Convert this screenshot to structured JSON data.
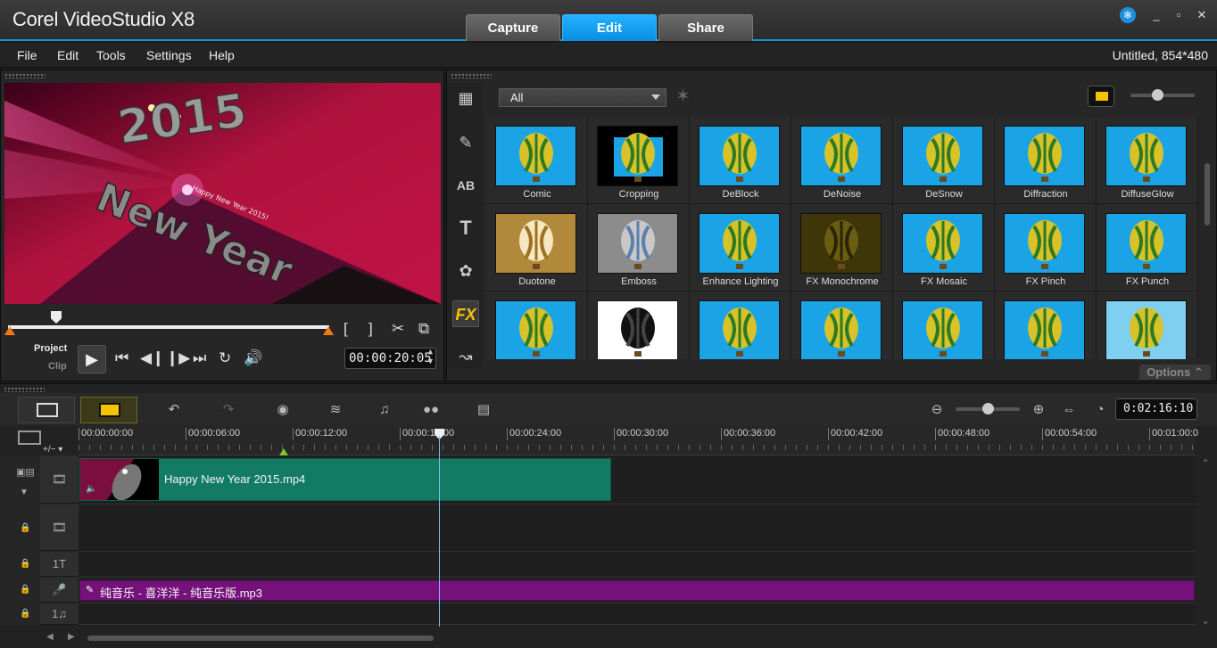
{
  "app": {
    "title": "Corel VideoStudio X8",
    "tabs": [
      "Capture",
      "Edit",
      "Share"
    ],
    "active_tab": "Edit",
    "window_buttons": [
      "_",
      "▫",
      "✕"
    ]
  },
  "menu": {
    "items": [
      "File",
      "Edit",
      "Tools",
      "Settings",
      "Help"
    ],
    "project_info": "Untitled, 854*480"
  },
  "player": {
    "mode_project": "Project",
    "mode_clip": "Clip",
    "timecode": "00:00:20:05",
    "trim_in_label": "[",
    "trim_out_label": "]",
    "video_text_big": "2015",
    "video_text_sub": "New Year",
    "video_text_small": "Happy New Year 2015!"
  },
  "library": {
    "filter_value": "All",
    "fx_tab_label": "FX",
    "effects": [
      "Comic",
      "Cropping",
      "DeBlock",
      "DeNoise",
      "DeSnow",
      "Diffraction",
      "DiffuseGlow",
      "Duotone",
      "Emboss",
      "Enhance Lighting",
      "FX Monochrome",
      "FX Mosaic",
      "FX Pinch",
      "FX Punch",
      "",
      "",
      "",
      "",
      "",
      "",
      ""
    ],
    "options_label": "Options"
  },
  "timeline": {
    "duration": "0:02:16:10",
    "ruler_ticks": [
      "00:00:00:00",
      "00:00:06:00",
      "00:00:12:00",
      "00:00:18:00",
      "00:00:24:00",
      "00:00:30:00",
      "00:00:36:00",
      "00:00:42:00",
      "00:00:48:00",
      "00:00:54:00",
      "00:01:00:0"
    ],
    "add_remove_label": "+/−",
    "video_clip_name": "Happy New Year 2015.mp4",
    "audio_clip_name": "纯音乐 - 喜洋洋 - 纯音乐版.mp3",
    "track_numbers": [
      "1",
      "1"
    ]
  },
  "colors": {
    "accent": "#0a9af0",
    "video_clip": "#137b64",
    "audio_clip": "#74127a",
    "fx_tab": "#f4c400"
  }
}
